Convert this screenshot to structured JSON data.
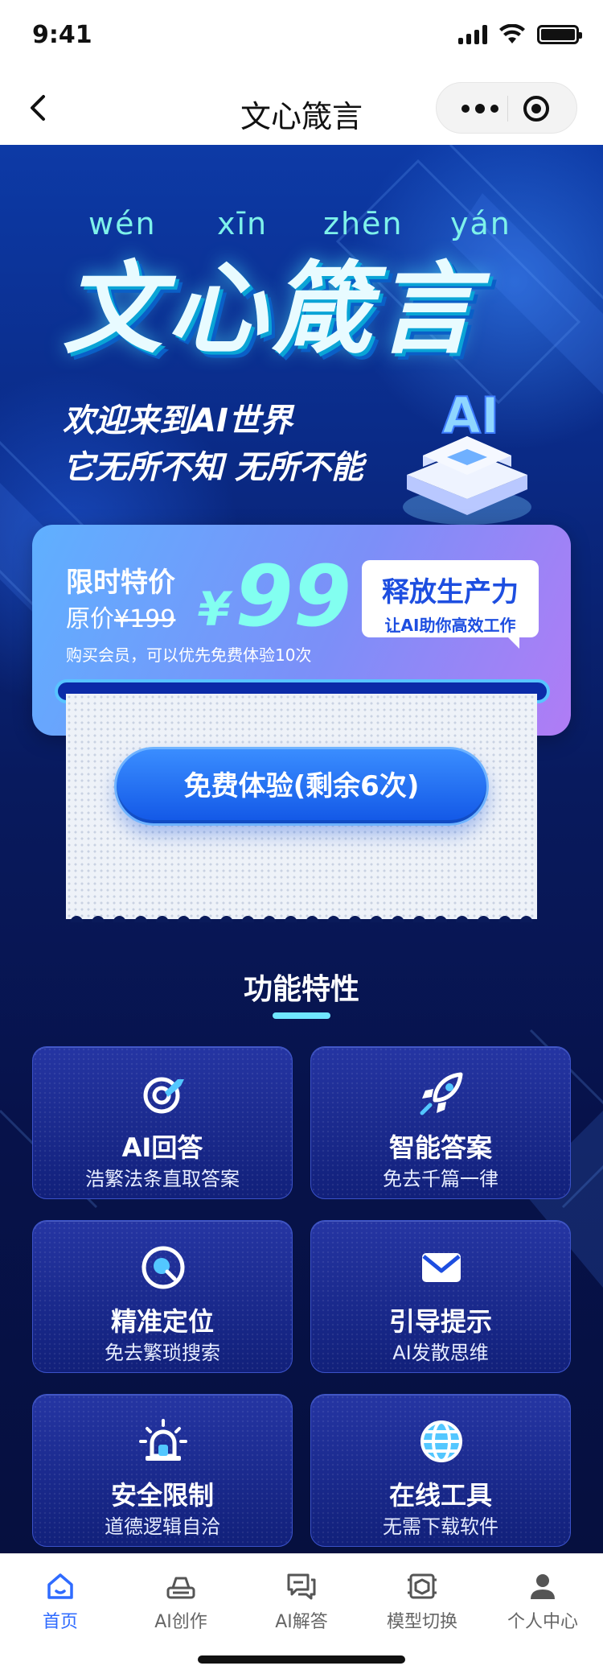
{
  "status_bar": {
    "time": "9:41"
  },
  "navbar": {
    "title": "文心箴言"
  },
  "hero": {
    "pinyin": [
      "wén",
      "xīn",
      "zhēn",
      "yán"
    ],
    "title": "文心箴言",
    "slogan_line1": "欢迎来到AI世界",
    "slogan_line2": "它无所不知 无所不能",
    "badge_text": "AI"
  },
  "price_card": {
    "label": "限时特价",
    "original_prefix": "原价",
    "original_price": "¥199",
    "currency": "¥",
    "price": "99",
    "note": "购买会员，可以优先免费体验10次",
    "bubble_title": "释放生产力",
    "bubble_sub": "让AI助你高效工作"
  },
  "cta": {
    "label": "免费体验(剩余6次)"
  },
  "features": {
    "title": "功能特性",
    "items": [
      {
        "title": "AI回答",
        "sub": "浩繁法条直取答案",
        "icon": "target-icon"
      },
      {
        "title": "智能答案",
        "sub": "免去千篇一律",
        "icon": "rocket-icon"
      },
      {
        "title": "精准定位",
        "sub": "免去繁琐搜索",
        "icon": "locate-icon"
      },
      {
        "title": "引导提示",
        "sub": "AI发散思维",
        "icon": "mail-icon"
      },
      {
        "title": "安全限制",
        "sub": "道德逻辑自洽",
        "icon": "alarm-icon"
      },
      {
        "title": "在线工具",
        "sub": "无需下载软件",
        "icon": "globe-icon"
      }
    ]
  },
  "tabbar": {
    "items": [
      {
        "label": "首页",
        "icon": "home-icon",
        "active": true
      },
      {
        "label": "AI创作",
        "icon": "creation-icon",
        "active": false
      },
      {
        "label": "AI解答",
        "icon": "chat-icon",
        "active": false
      },
      {
        "label": "模型切换",
        "icon": "model-switch-icon",
        "active": false
      },
      {
        "label": "个人中心",
        "icon": "user-icon",
        "active": false
      }
    ]
  },
  "colors": {
    "accent": "#2f6bff",
    "price_color": "#82fff0",
    "pinyin_color": "#7ef2ea",
    "bg_dark": "#07124a"
  }
}
